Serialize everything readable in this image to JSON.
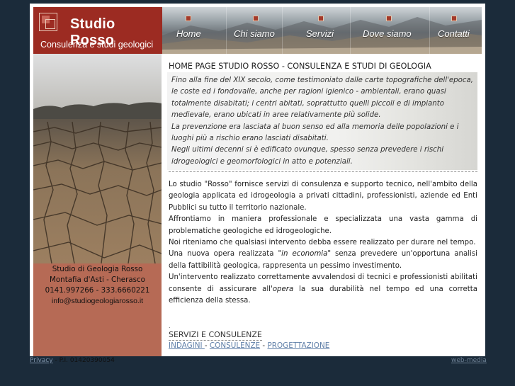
{
  "brand": {
    "name": "Studio Rosso",
    "tagline": "Consulenza e studi geologici"
  },
  "nav": {
    "items": [
      {
        "label": "Home"
      },
      {
        "label": "Chi siamo"
      },
      {
        "label": "Servizi"
      },
      {
        "label": "Dove siamo"
      },
      {
        "label": "Contatti"
      }
    ]
  },
  "contact": {
    "line1": "Studio di Geologia Rosso",
    "line2": "Montafia d'Asti - Cherasco",
    "phones": "0141.997266 - 333.6660221",
    "email": "info@studiogeologiarosso.it"
  },
  "main": {
    "title": "HOME PAGE STUDIO ROSSO - CONSULENZA E STUDI DI GEOLOGIA",
    "intro": [
      "Fino alla fine del XIX secolo, come testimoniato dalle carte topografiche dell'epoca, le coste ed i fondovalle, anche per ragioni igienico - ambientali, erano quasi totalmente disabitati; i centri abitati, soprattutto quelli piccoli e di impianto medievale, erano ubicati in aree relativamente più solide.",
      "La prevenzione era lasciata al buon senso ed alla memoria delle popolazioni e i luoghi più a rischio erano lasciati disabitati.",
      "Negli ultimi decenni si è edificato ovunque, spesso senza prevedere i rischi idrogeologici e geomorfologici in atto e potenziali."
    ],
    "paragraphs": {
      "p1": "Lo studio \"Rosso\"  fornisce servizi di consulenza e supporto tecnico, nell'ambito della geologia applicata ed idrogeologia a privati cittadini, professionisti, aziende ed Enti Pubblici su tutto il territorio  nazionale.",
      "p2": "Affrontiamo in maniera professionale e specializzata una vasta gamma di problematiche  geologiche ed idrogeologiche.",
      "p3": "Noi riteniamo che qualsiasi intervento debba essere realizzato per durare nel tempo.",
      "p4_a": "Una  nuova opera realizzata ",
      "p4_em": "\"in economia\"",
      "p4_b": "  senza prevedere un'opportuna analisi della fattibilità geologica, rappresenta un pessimo investimento.",
      "p5_a": "Un'intervento realizzato correttamente avvalendosi di tecnici e professionisti abilitati consente di assicurare all'",
      "p5_em": "opera",
      "p5_b": " la sua durabilità nel tempo ed una corretta efficienza della stessa."
    },
    "tiny_mark": ".",
    "services": {
      "title": "SERVIZI E CONSULENZE",
      "links": [
        "INDAGINI ",
        "CONSULENZE",
        "PROGETTAZIONE"
      ],
      "separator": " - "
    }
  },
  "footer": {
    "privacy": "Privacy",
    "vat": " - P.I. 01420390054",
    "credit": "web-media"
  }
}
